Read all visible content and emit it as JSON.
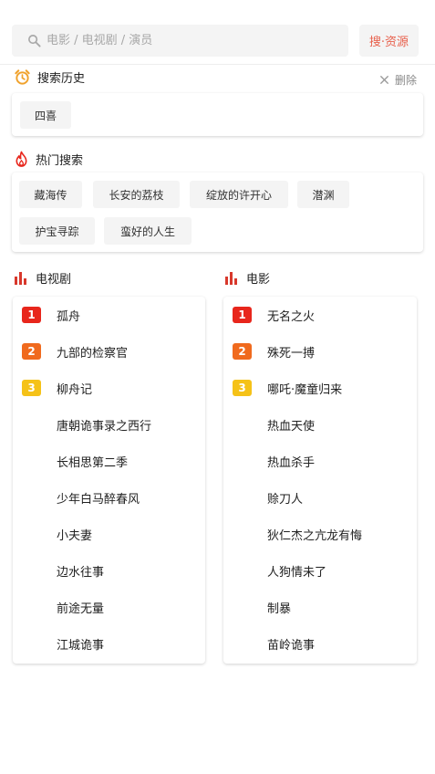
{
  "search": {
    "placeholder": "电影 / 电视剧 / 演员",
    "value": "",
    "button_label": "搜·资源"
  },
  "history": {
    "title": "搜索历史",
    "delete_label": "删除",
    "items": [
      "四喜"
    ]
  },
  "hot_search": {
    "title": "热门搜索",
    "items": [
      "藏海传",
      "长安的荔枝",
      "绽放的许开心",
      "潜渊",
      "护宝寻踪",
      "蛮好的人生"
    ]
  },
  "tv_rank": {
    "title": "电视剧",
    "items": [
      {
        "rank": "1",
        "title": "孤舟"
      },
      {
        "rank": "2",
        "title": "九部的检察官"
      },
      {
        "rank": "3",
        "title": "柳舟记"
      },
      {
        "rank": "",
        "title": "唐朝诡事录之西行"
      },
      {
        "rank": "",
        "title": "长相思第二季"
      },
      {
        "rank": "",
        "title": "少年白马醉春风"
      },
      {
        "rank": "",
        "title": "小夫妻"
      },
      {
        "rank": "",
        "title": "边水往事"
      },
      {
        "rank": "",
        "title": "前途无量"
      },
      {
        "rank": "",
        "title": "江城诡事"
      }
    ]
  },
  "movie_rank": {
    "title": "电影",
    "items": [
      {
        "rank": "1",
        "title": "无名之火"
      },
      {
        "rank": "2",
        "title": "殊死一搏"
      },
      {
        "rank": "3",
        "title": "哪吒·魔童归来"
      },
      {
        "rank": "",
        "title": "热血天使"
      },
      {
        "rank": "",
        "title": "热血杀手"
      },
      {
        "rank": "",
        "title": "赊刀人"
      },
      {
        "rank": "",
        "title": "狄仁杰之亢龙有悔"
      },
      {
        "rank": "",
        "title": "人狗情未了"
      },
      {
        "rank": "",
        "title": "制暴"
      },
      {
        "rank": "",
        "title": "苗岭诡事"
      }
    ]
  },
  "colors": {
    "accent": "#e8604c",
    "rank1": "#e8261c",
    "rank2": "#f06a1e",
    "rank3": "#f5c218",
    "history_icon": "#f0a22c",
    "hot_icon": "#e8261c",
    "rank_icon": "#d8382c"
  },
  "icons": {
    "search": "search-icon",
    "history": "alarm-clock-icon",
    "delete": "close-icon",
    "hot": "flame-icon",
    "rank": "bar-chart-icon"
  }
}
